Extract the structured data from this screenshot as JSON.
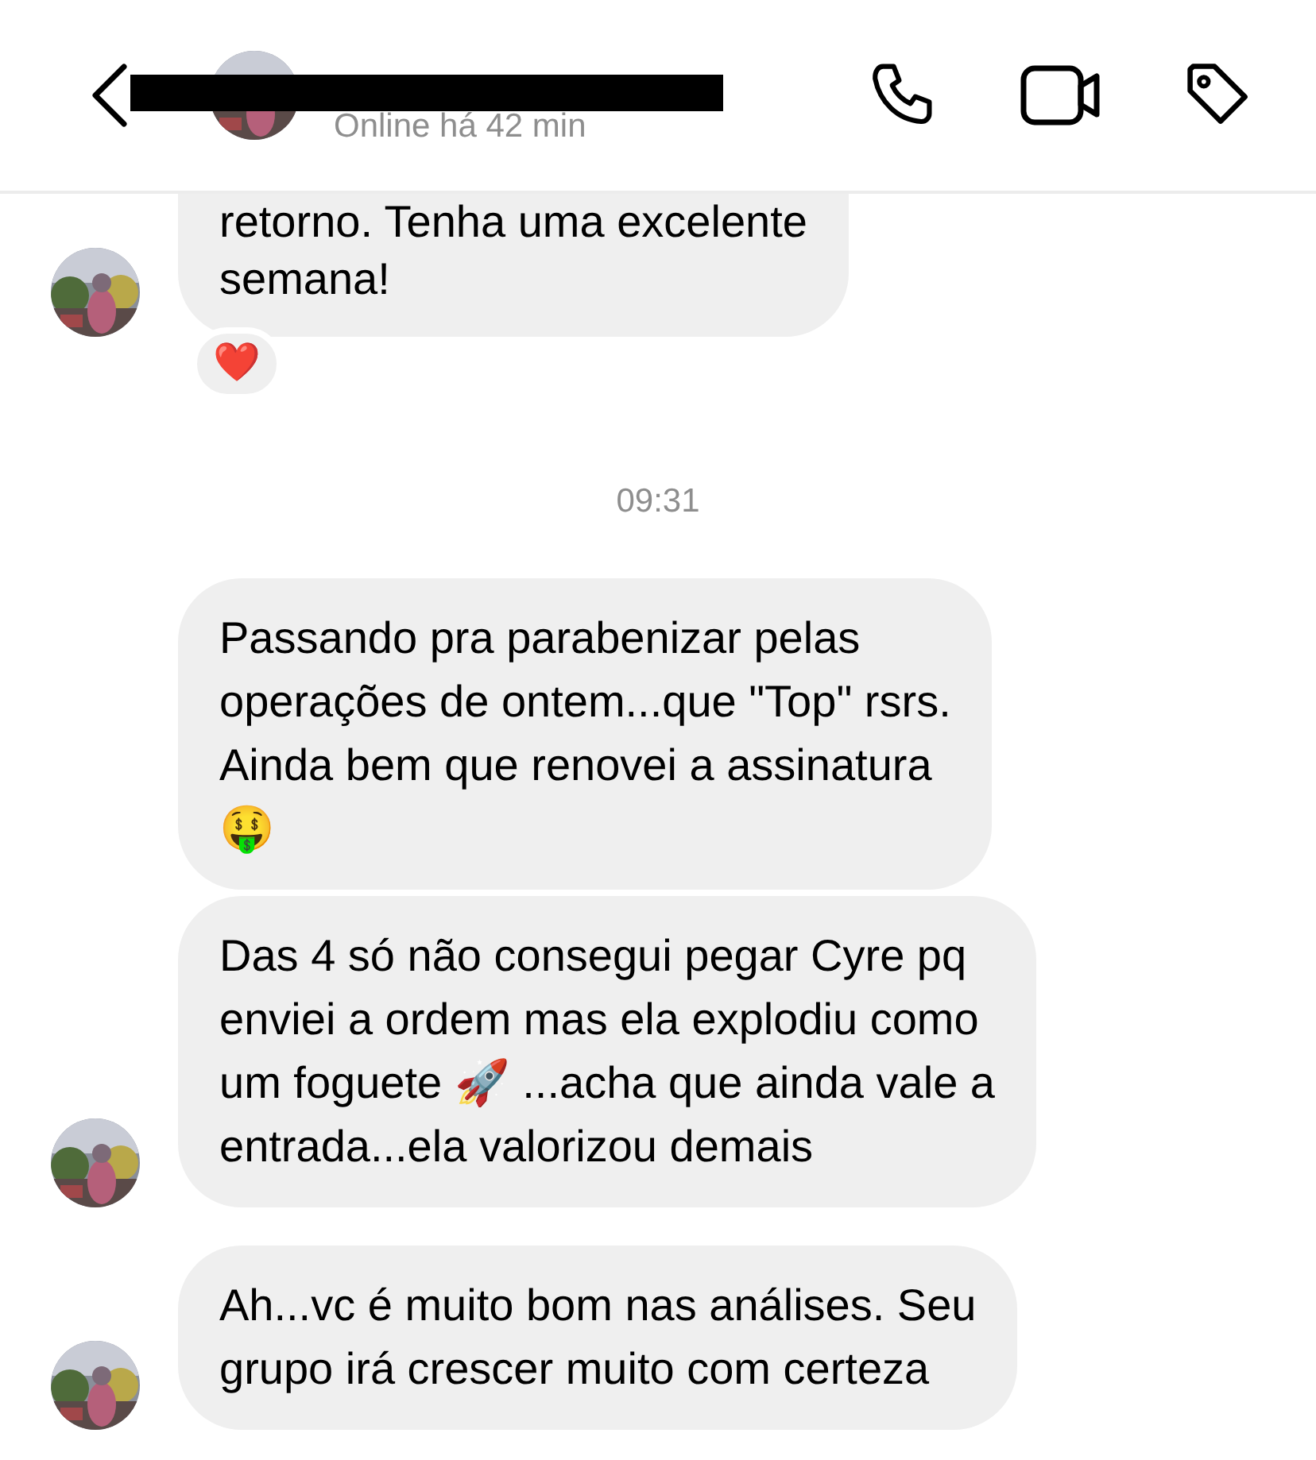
{
  "header": {
    "status": "Online há 42 min",
    "name_redacted": true
  },
  "messages": [
    {
      "kind": "message",
      "text": "retorno. Tenha uma excelente\nsemana!",
      "avatar": true,
      "reaction": "❤️",
      "cut_top": true
    },
    {
      "kind": "timestamp",
      "text": "09:31"
    },
    {
      "kind": "message",
      "text": "Passando pra parabenizar pelas\noperações de ontem...que \"Top\" rsrs.\nAinda bem que renovei a assinatura\n🤑",
      "avatar": false
    },
    {
      "kind": "message",
      "text": "Das 4 só não consegui pegar Cyre pq\nenviei a ordem mas ela explodiu como\num foguete 🚀 ...acha que ainda vale a\nentrada...ela valorizou demais",
      "avatar": true
    },
    {
      "kind": "message",
      "text": "Ah...vc é muito bom nas análises. Seu\ngrupo irá crescer muito com certeza",
      "avatar": true
    }
  ]
}
